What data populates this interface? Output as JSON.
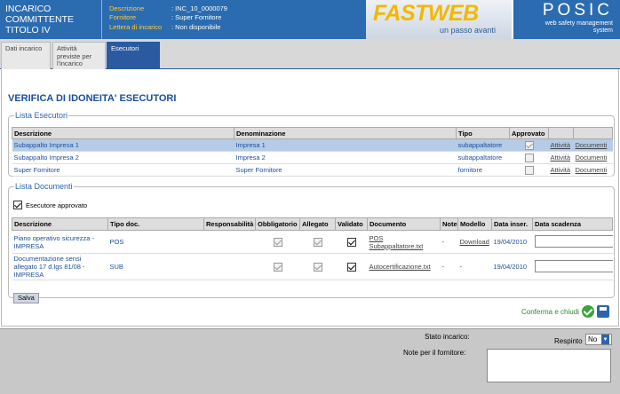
{
  "header": {
    "title": "INCARICO COMMITTENTE TITOLO IV",
    "info": [
      {
        "k": "Descrizione",
        "v": ": INC_10_0000079"
      },
      {
        "k": "Fornitore",
        "v": ": Super Fornitore"
      },
      {
        "k": "Lettera di incarico",
        "v": ": Non disponibile"
      }
    ],
    "fastweb": "FASTWEB",
    "fastweb_tag": "un passo avanti",
    "posic": "POSIC",
    "posic_tag": "web safety management system"
  },
  "tabs": [
    "Dati incarico",
    "Attività previste per l'incarico",
    "Esecutori"
  ],
  "page_title": "VERIFICA DI IDONEITA' ESECUTORI",
  "lista_esecutori": {
    "legend": "Lista Esecutori",
    "cols": [
      "Descrizione",
      "Denominazione",
      "Tipo",
      "Approvato",
      "",
      ""
    ],
    "rows": [
      {
        "descr": "Subappalto Impresa 1",
        "den": "Impresa 1",
        "tipo": "subappaltatore",
        "approvato": true,
        "a1": "Attività",
        "a2": "Documenti"
      },
      {
        "descr": "Subappalto Impresa 2",
        "den": "Impresa 2",
        "tipo": "subappaltatore",
        "approvato": false,
        "a1": "Attività",
        "a2": "Documenti"
      },
      {
        "descr": "Super Fornitore",
        "den": "Super Fornitore",
        "tipo": "fornitore",
        "approvato": false,
        "a1": "Attività",
        "a2": "Documenti"
      }
    ]
  },
  "lista_documenti": {
    "legend": "Lista Documenti",
    "esecutore_approvato": "Esecutore approvato",
    "cols": [
      "Descrizione",
      "Tipo doc.",
      "Responsabilità",
      "Obbligatorio",
      "Allegato",
      "Validato",
      "Documento",
      "Note",
      "Modello",
      "Data inser.",
      "Data scadenza"
    ],
    "rows": [
      {
        "descr": "Piano operativo sicurezza - IMPRESA",
        "tipo": "POS",
        "doc": "POS Subappaltatore.txt",
        "note": "-",
        "modello": "Download",
        "data": "19/04/2010"
      },
      {
        "descr": "Documentazione sensi allegato 17 d.lgs 81/08 - IMPRESA",
        "tipo": "SUB",
        "doc": "Autocertificazione.txt",
        "note": "-",
        "modello": "-",
        "data": "19/04/2010"
      }
    ],
    "salva": "Salva"
  },
  "confirm": "Conferma e chiudi",
  "bottom": {
    "stato": "Stato incarico:",
    "respinto": "Respinto",
    "select": "No",
    "note": "Note per il fornitore:"
  }
}
